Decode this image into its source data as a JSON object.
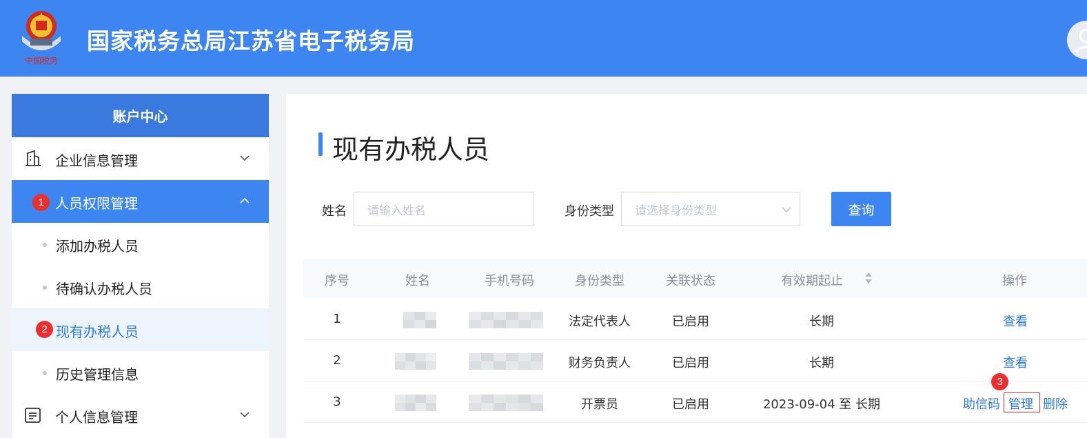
{
  "header": {
    "site_title": "国家税务总局江苏省电子税务局",
    "logo_caption": "中国税务"
  },
  "sidebar": {
    "title": "账户中心",
    "groups": [
      {
        "label": "企业信息管理",
        "icon": "building-icon",
        "expanded": false
      },
      {
        "label": "人员权限管理",
        "icon": "person-icon",
        "expanded": true,
        "step": "1"
      },
      {
        "label": "个人信息管理",
        "icon": "id-card-icon",
        "expanded": false
      }
    ],
    "sub_items": [
      {
        "label": "添加办税人员"
      },
      {
        "label": "待确认办税人员"
      },
      {
        "label": "现有办税人员",
        "current": true,
        "step": "2"
      },
      {
        "label": "历史管理信息"
      }
    ]
  },
  "main": {
    "page_title": "现有办税人员",
    "filters": {
      "name_label": "姓名",
      "name_placeholder": "请输入姓名",
      "type_label": "身份类型",
      "type_placeholder": "请选择身份类型",
      "query_label": "查询"
    },
    "table": {
      "columns": [
        "序号",
        "姓名",
        "手机号码",
        "身份类型",
        "关联状态",
        "有效期起止",
        "操作"
      ],
      "rows": [
        {
          "index": "1",
          "type": "法定代表人",
          "status": "已启用",
          "validity": "长期",
          "ops": [
            "查看"
          ]
        },
        {
          "index": "2",
          "type": "财务负责人",
          "status": "已启用",
          "validity": "长期",
          "ops": [
            "查看"
          ]
        },
        {
          "index": "3",
          "type": "开票员",
          "status": "已启用",
          "validity": "2023-09-04 至 长期",
          "ops": [
            "助信码",
            "管理",
            "删除"
          ],
          "step": "3"
        }
      ]
    }
  },
  "colors": {
    "primary": "#3d86f2",
    "sidebar_header": "#3a79dd",
    "badge": "#ec2e2e",
    "link": "#2f78e6"
  }
}
